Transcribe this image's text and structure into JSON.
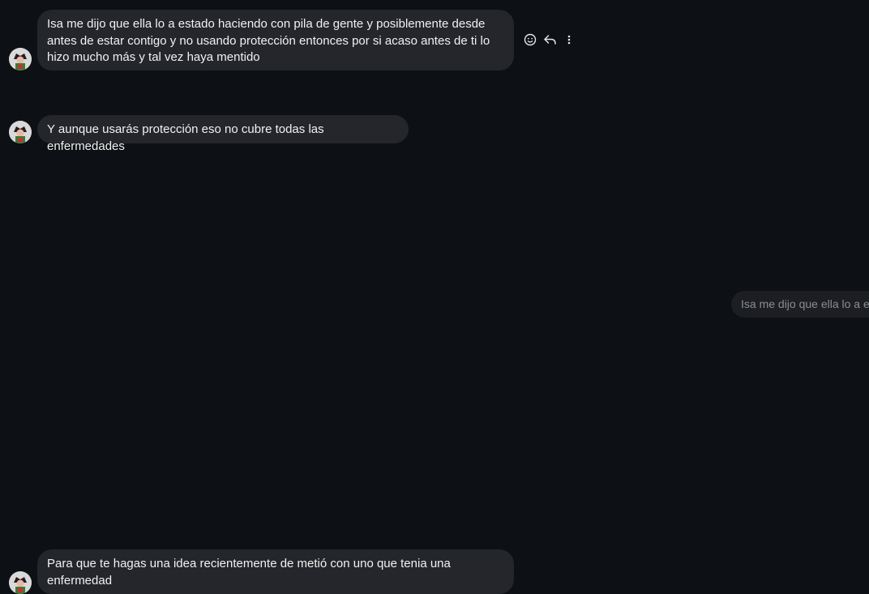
{
  "messages": [
    {
      "text": "Isa me dijo que ella lo a estado haciendo con pila de gente y posiblemente desde antes de estar contigo y no usando protección entonces por si acaso antes de ti lo hizo mucho más y tal vez haya mentido"
    },
    {
      "text": "Y aunque usarás protección eso no cubre todas las enfermedades"
    },
    {
      "text": "Para que te hagas una idea recientemente de metió con uno que tenia una enfermedad"
    }
  ],
  "message_actions": {
    "icons": [
      "smiley-icon",
      "reply-icon",
      "more-vertical-icon"
    ]
  },
  "reply_preview": {
    "text": "Isa me dijo que ella lo a estado haciendo con pila de gente"
  },
  "colors": {
    "background": "#0d1014",
    "bubble": "#24262b",
    "bubble_text": "#f1f1f2",
    "muted_text": "#8a8d91"
  }
}
